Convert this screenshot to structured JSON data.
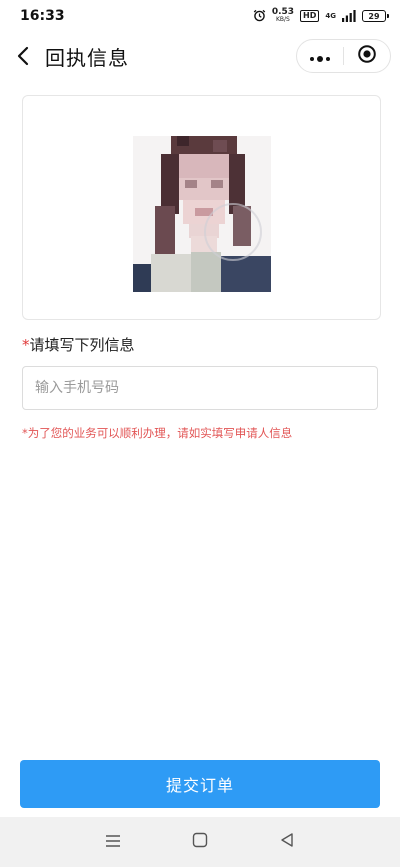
{
  "status_bar": {
    "time": "16:33",
    "net_speed_value": "0.53",
    "net_speed_unit": "KB/S",
    "hd_label": "HD",
    "network_label": "4G",
    "battery_level": "29",
    "icons": [
      "alarm-icon",
      "signal-icon",
      "battery-icon"
    ]
  },
  "header": {
    "title": "回执信息",
    "icons": [
      "back-arrow-icon",
      "more-dots-icon",
      "close-target-icon"
    ]
  },
  "photo": {
    "description_icon": "portrait-photo"
  },
  "form": {
    "section_required_mark": "*",
    "section_label": "请填写下列信息",
    "phone_placeholder": "输入手机号码",
    "phone_value": "",
    "hint": "*为了您的业务可以顺利办理，请如实填写申请人信息"
  },
  "submit": {
    "label": "提交订单"
  },
  "nav_bar": {
    "icons": [
      "menu-icon",
      "home-square-icon",
      "back-triangle-icon"
    ]
  },
  "colors": {
    "accent": "#2e9bf5",
    "required": "#e03a3a",
    "hint": "#e25555",
    "nav_bg": "#f1f1f1"
  }
}
